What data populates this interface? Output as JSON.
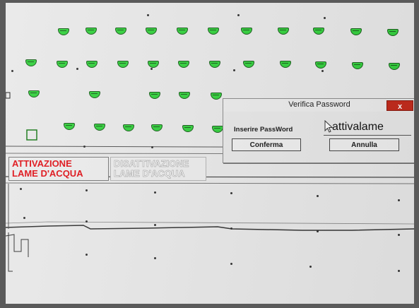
{
  "left_panel": {
    "activate_label_line1": "ATTIVAZIONE",
    "activate_label_line2": "LAME D'ACQUA",
    "deactivate_label_line1": "DISATTIVAZIONE",
    "deactivate_label_line2": "LAME D'ACQUA"
  },
  "dialog": {
    "title": "Verifica Password",
    "close_label": "x",
    "password_label": "Inserire PassWord",
    "password_value": "attivalame",
    "confirm_label": "Conferma",
    "cancel_label": "Annulla"
  },
  "colors": {
    "nozzle_active": "#35d13f",
    "activate_text": "#e0151b",
    "close_button": "#c42b1c"
  },
  "icons": {
    "nozzle": "water-nozzle-icon",
    "cursor": "mouse-pointer-icon"
  }
}
